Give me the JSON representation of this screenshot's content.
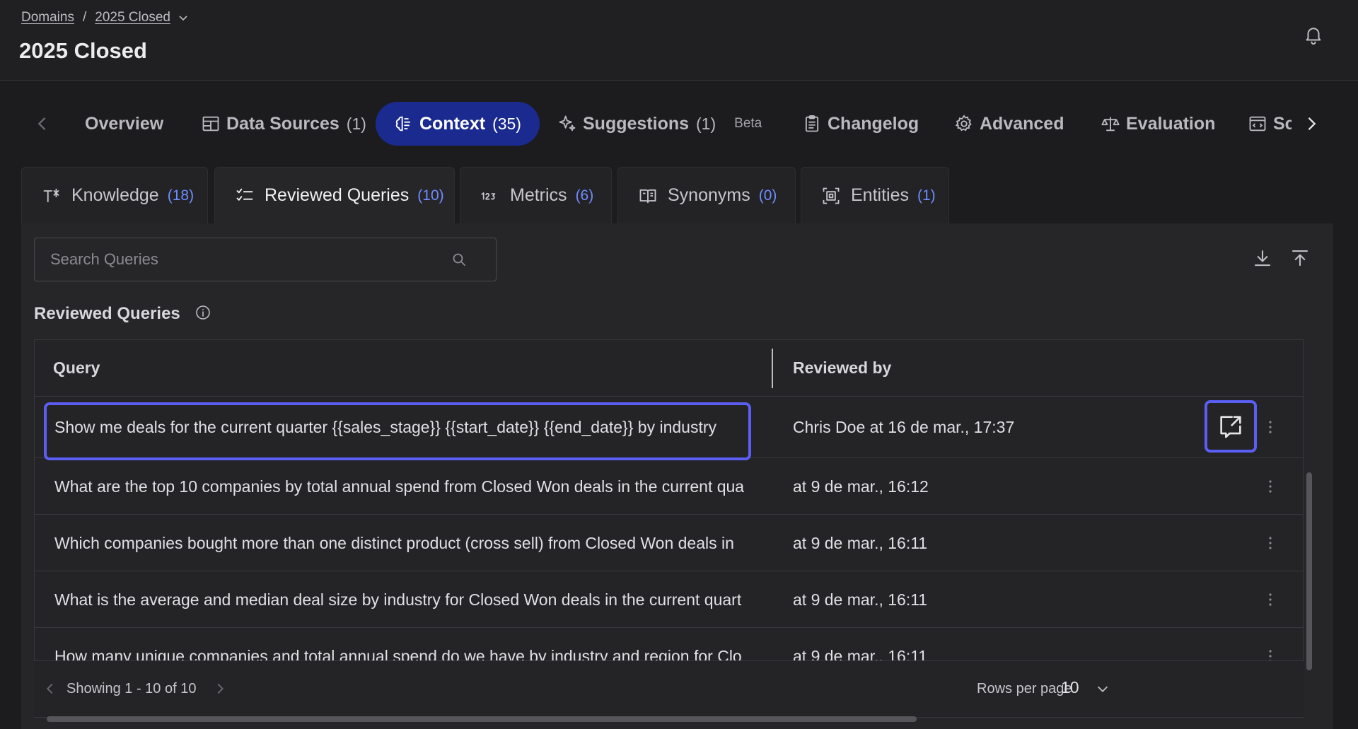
{
  "breadcrumb": {
    "root": "Domains",
    "separator": "/",
    "current": "2025 Closed"
  },
  "page": {
    "title": "2025 Closed"
  },
  "main_tabs": [
    {
      "label": "Overview",
      "count": ""
    },
    {
      "label": "Data Sources",
      "count": "(1)"
    },
    {
      "label": "Context",
      "count": "(35)",
      "active": true
    },
    {
      "label": "Suggestions",
      "count": "(1)",
      "badge": "Beta"
    },
    {
      "label": "Changelog",
      "count": ""
    },
    {
      "label": "Advanced",
      "count": ""
    },
    {
      "label": "Evaluation",
      "count": ""
    },
    {
      "label": "Sc",
      "count": ""
    }
  ],
  "sub_tabs": [
    {
      "label": "Knowledge",
      "count": "(18)"
    },
    {
      "label": "Reviewed Queries",
      "count": "(10)",
      "active": true
    },
    {
      "label": "Metrics",
      "count": "(6)"
    },
    {
      "label": "Synonyms",
      "count": "(0)"
    },
    {
      "label": "Entities",
      "count": "(1)"
    }
  ],
  "search": {
    "placeholder": "Search Queries",
    "value": ""
  },
  "section": {
    "title": "Reviewed Queries"
  },
  "table": {
    "columns": [
      "Query",
      "Reviewed by"
    ],
    "rows": [
      {
        "query": "Show me deals for the current quarter {{sales_stage}} {{start_date}} {{end_date}} by industry",
        "reviewed_by": "Chris Doe at 16 de mar., 17:37"
      },
      {
        "query": "What are the top 10 companies by total annual spend from Closed Won deals in the current qua",
        "reviewed_by": "at 9 de mar., 16:12"
      },
      {
        "query": "Which companies bought more than one distinct product (cross sell) from Closed Won deals in",
        "reviewed_by": "at 9 de mar., 16:11"
      },
      {
        "query": "What is the average and median deal size by industry for Closed Won deals in the current quart",
        "reviewed_by": "at 9 de mar., 16:11"
      },
      {
        "query": "How many unique companies and total annual spend do we have by industry and region for Clo",
        "reviewed_by": "at 9 de mar., 16:11"
      }
    ]
  },
  "pagination": {
    "showing": "Showing 1 - 10 of 10",
    "rows_per_page_label": "Rows per page",
    "rows_per_page": "10"
  },
  "colors": {
    "accent": "#5b5ef5",
    "active_tab": "#1b2a8f",
    "count": "#6f8dff"
  }
}
